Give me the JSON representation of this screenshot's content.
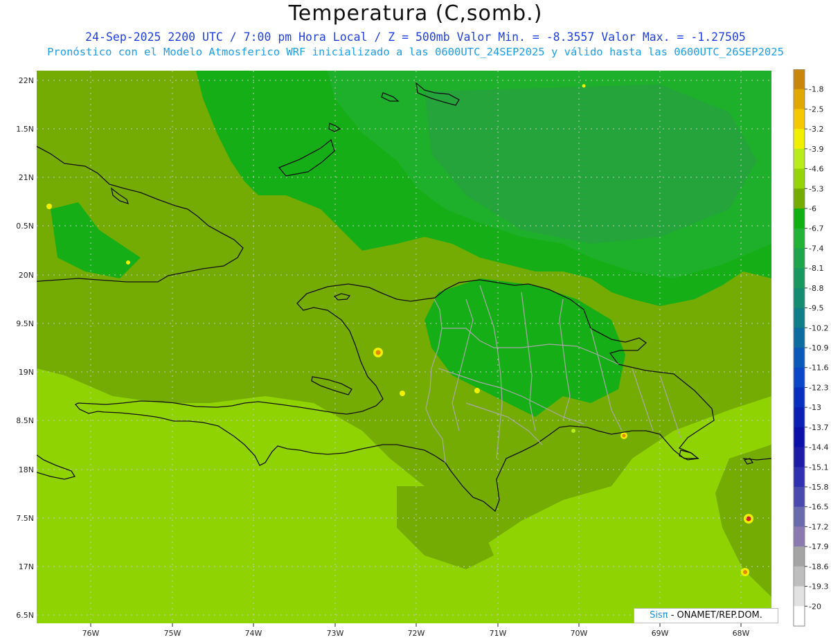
{
  "header": {
    "title": "Temperatura (C,somb.)",
    "line1": "24-Sep-2025  2200 UTC / 7:00 pm Hora Local / Z = 500mb   Valor Min. = -8.3557  Valor Max. = -1.27505",
    "line2": "Pronóstico con el Modelo Atmosferico WRF inicializado a las 0600UTC_24SEP2025 y válido hasta las  0600UTC_26SEP2025"
  },
  "axes": {
    "lat_labels": [
      "22N",
      "1.5N",
      "21N",
      "0.5N",
      "20N",
      "9.5N",
      "19N",
      "8.5N",
      "18N",
      "7.5N",
      "17N",
      "6.5N"
    ],
    "lon_labels": [
      "76W",
      "75W",
      "74W",
      "73W",
      "72W",
      "71W",
      "70W",
      "69W",
      "68W"
    ]
  },
  "colorbar": {
    "labels": [
      "-1.8",
      "-2.5",
      "-3.2",
      "-3.9",
      "-4.6",
      "-5.3",
      "-6",
      "-6.7",
      "-7.4",
      "-8.1",
      "-8.8",
      "-9.5",
      "-10.2",
      "-10.9",
      "-11.6",
      "-12.3",
      "-13",
      "-13.7",
      "-14.4",
      "-15.1",
      "-15.8",
      "-16.5",
      "-17.2",
      "-17.9",
      "-18.6",
      "-19.3",
      "-20"
    ],
    "colors": [
      "#c8860a",
      "#e0a800",
      "#f5c800",
      "#f0f000",
      "#b8ec1a",
      "#96d40a",
      "#74ac04",
      "#10b010",
      "#22b236",
      "#1ea44a",
      "#18985e",
      "#148c72",
      "#107e88",
      "#0c6ca0",
      "#0a58b8",
      "#0a46c8",
      "#0830c0",
      "#0a20b4",
      "#0a10a8",
      "#1c1ca6",
      "#3030b0",
      "#4a4aae",
      "#6a6aae",
      "#8a7ab0",
      "#a4a4a4",
      "#bebebe",
      "#e2e2e2",
      "#ffffff"
    ]
  },
  "map_colors": {
    "sea_south": "#8fd402",
    "mid_band": "#74ac04",
    "north": "#16ae16",
    "north_dark": "#24a43a",
    "outline": "#111111",
    "borders": "#a8a8a8",
    "hotspot_yellow": "#f0f000",
    "hotspot_orange": "#e08a00",
    "hotspot_red": "#d02020"
  },
  "credit": {
    "sis": "Sisπ",
    "rest": "- ONAMET/REP.DOM."
  }
}
